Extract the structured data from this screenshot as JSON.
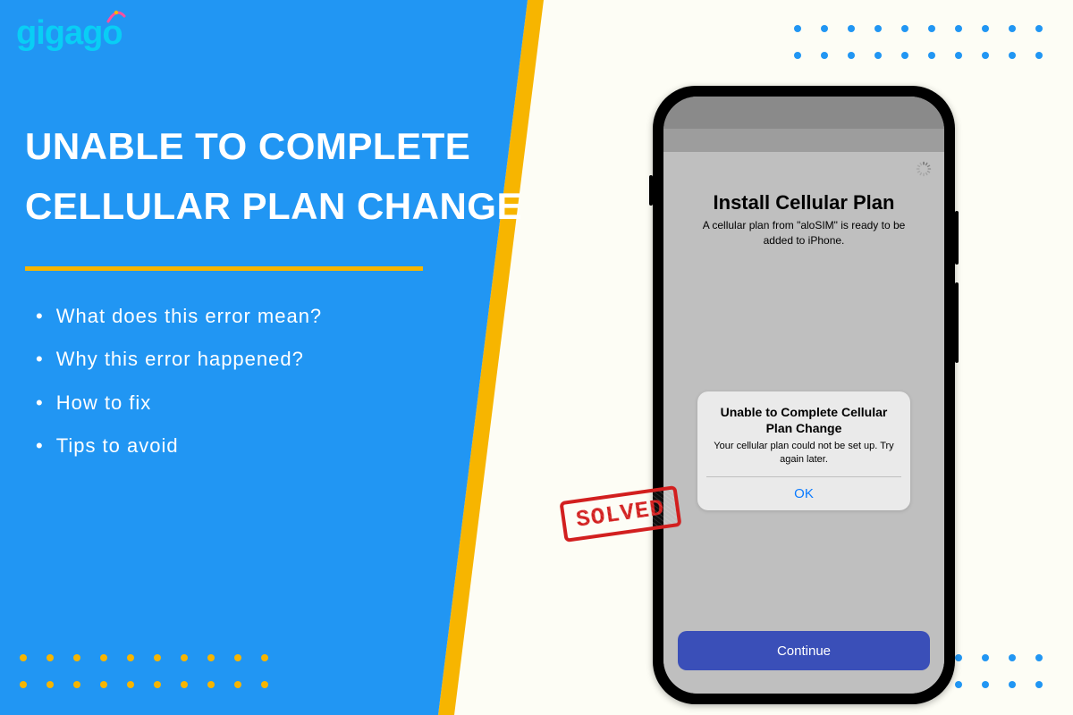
{
  "logo": {
    "text": "gigago"
  },
  "headline": {
    "line1": "UNABLE TO COMPLETE",
    "line2": "CELLULAR PLAN CHANGE"
  },
  "bullets": [
    "What does this error mean?",
    "Why this error happened?",
    "How to fix",
    "Tips to avoid"
  ],
  "phone": {
    "install_title": "Install Cellular Plan",
    "install_subtitle": "A cellular plan from \"aloSIM\" is ready to be added to iPhone.",
    "alert": {
      "title": "Unable to Complete Cellular Plan Change",
      "body": "Your cellular plan could not be set up. Try again later.",
      "ok_label": "OK"
    },
    "continue_label": "Continue"
  },
  "stamp": {
    "text": "SOLVED"
  },
  "colors": {
    "blue": "#2196f3",
    "yellow": "#f7b500",
    "red": "#d21f1f",
    "ios_blue": "#0a7aff",
    "button_indigo": "#3a4fb8"
  }
}
